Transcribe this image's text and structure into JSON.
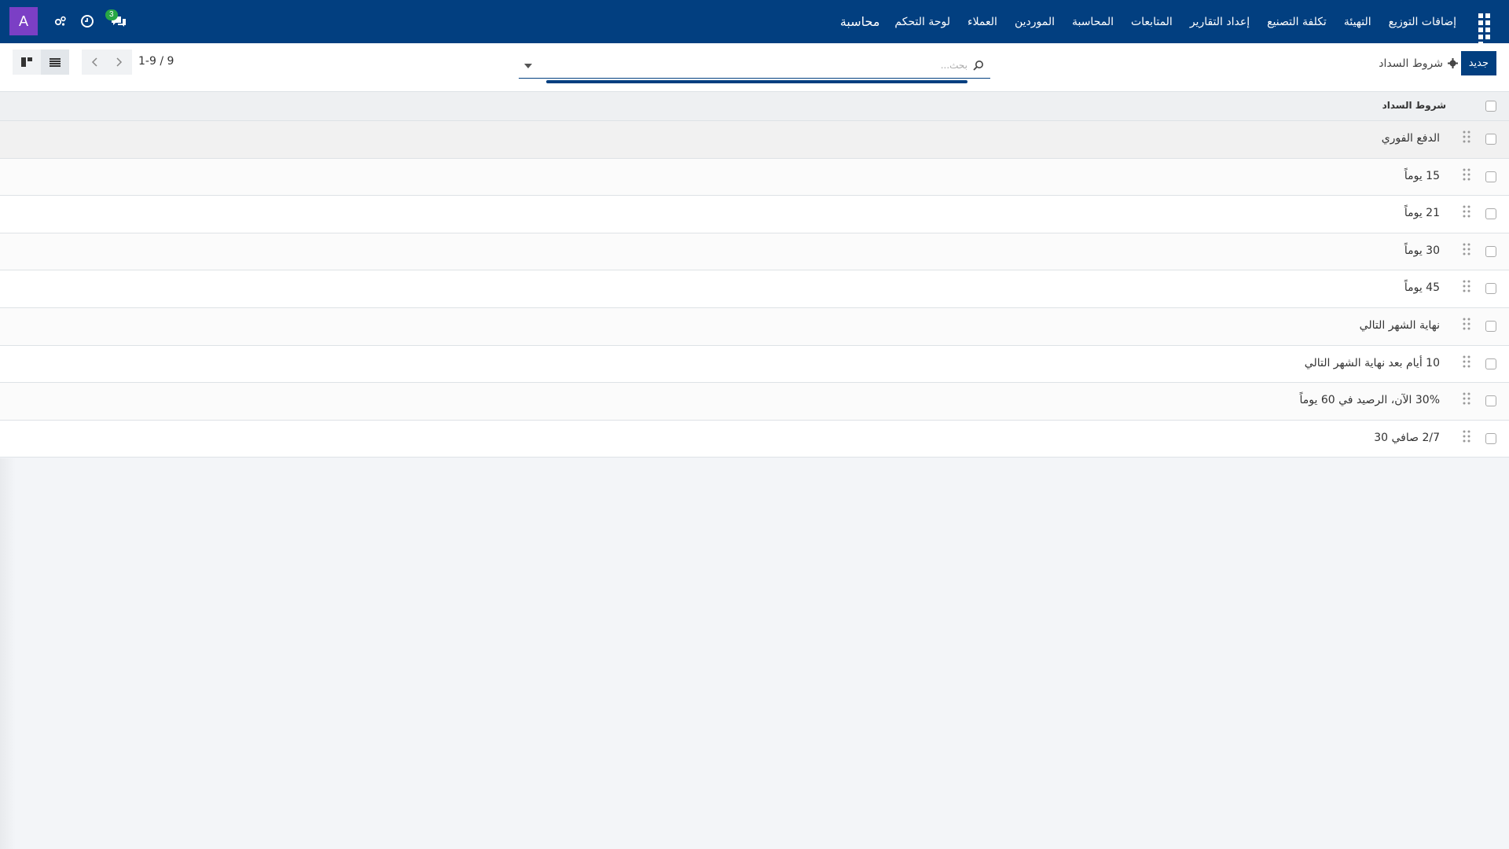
{
  "navbar": {
    "brand": "محاسبة",
    "menu": [
      "لوحة التحكم",
      "العملاء",
      "الموردين",
      "المحاسبة",
      "المتابعات",
      "إعداد التقارير",
      "تكلفة التصنيع",
      "التهيئة",
      "إضافات التوزيع"
    ],
    "avatar_letter": "A",
    "chat_badge": "3",
    "icons": [
      "apps-grid-icon",
      "chat-icon",
      "clock-icon",
      "debug-icon"
    ]
  },
  "control": {
    "new_label": "جديد",
    "title": "شروط السداد",
    "search_placeholder": "بحث...",
    "pager": "1-9 / 9"
  },
  "list": {
    "column": "شروط السداد",
    "rows": [
      "الدفع الفوري",
      "15 يوماً",
      "21 يوماً",
      "30 يوماً",
      "45 يوماً",
      "نهاية الشهر التالي",
      "10 أيام بعد نهاية الشهر التالي",
      "30% الآن، الرصيد في 60 يوماً",
      "2/7 صافي 30"
    ]
  },
  "colors": {
    "navbar": "#023f80",
    "avatar": "#7b3fc5",
    "badge": "#28a745"
  }
}
